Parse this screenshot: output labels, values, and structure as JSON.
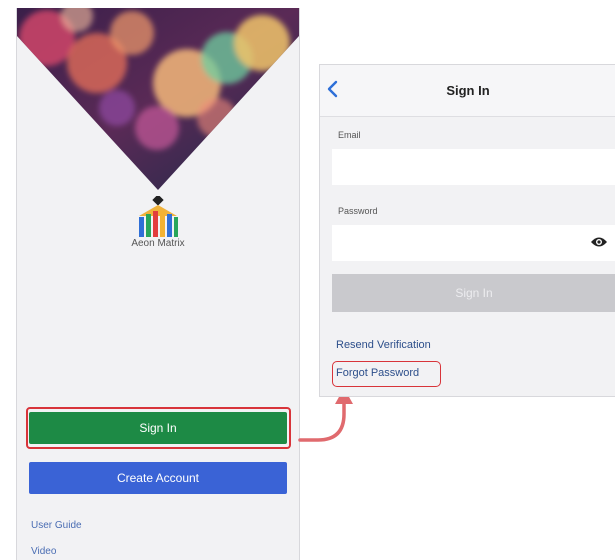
{
  "left_screen": {
    "brand_name": "Aeon Matrix",
    "signin_label": "Sign In",
    "create_account_label": "Create Account",
    "links": [
      "User Guide",
      "Video"
    ]
  },
  "right_screen": {
    "title": "Sign In",
    "email_label": "Email",
    "email_value": "",
    "password_label": "Password",
    "password_value": "",
    "signin_label": "Sign In",
    "resend_label": "Resend Verification",
    "forgot_label": "Forgot Password"
  },
  "colors": {
    "signin_green": "#1d8a45",
    "create_blue": "#3a63d6",
    "highlight_red": "#d8343a",
    "disabled_gray": "#c9c9cd"
  },
  "icons": [
    "back-chevron-icon",
    "eye-icon",
    "aeon-matrix-logo"
  ]
}
